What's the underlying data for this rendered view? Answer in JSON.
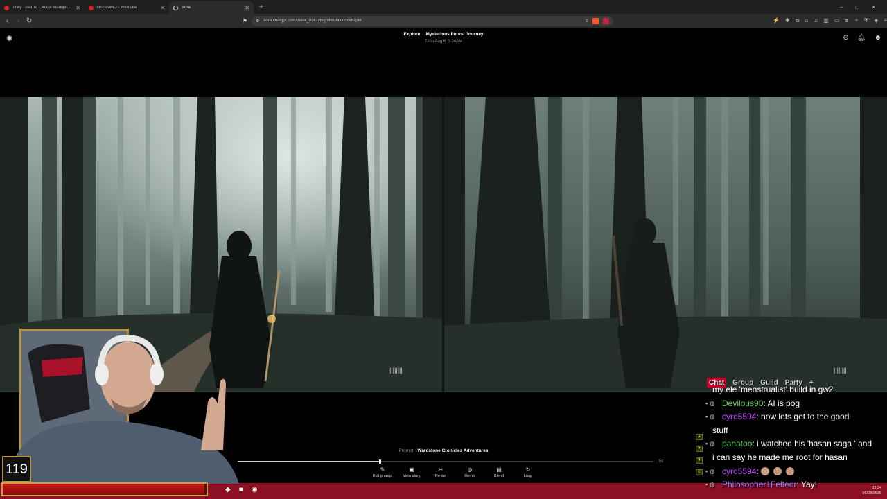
{
  "browser": {
    "tabs": [
      {
        "title": "They Tried To Cancel Markiplier... It",
        "icon": "youtube-icon"
      },
      {
        "title": "RozeMMO - YouTube",
        "icon": "youtube-icon"
      },
      {
        "title": "Sora",
        "icon": "sora-icon",
        "active": true
      }
    ],
    "url": "sora.chatgpt.com/t/task_01k1yfejg9f8s9akx3bfv6zpkr",
    "window_controls": [
      "–",
      "□",
      "✕"
    ]
  },
  "sora": {
    "breadcrumb_section": "Explore",
    "breadcrumb_sep": "·",
    "title": "Mysterious Forest Journey",
    "meta": "720p   Aug 6, 3:20AM",
    "prompt_label": "Prompt",
    "prompt_text": "Wardstone Cronicles Adventures",
    "progress": 0.34,
    "duration_label": "5s",
    "actions": [
      {
        "label": "Edit prompt",
        "icon": "pencil-icon",
        "glyph": "✎"
      },
      {
        "label": "View story",
        "icon": "storyboard-icon",
        "glyph": "▣"
      },
      {
        "label": "Re-cut",
        "icon": "scissors-icon",
        "glyph": "✂"
      },
      {
        "label": "Remix",
        "icon": "remix-icon",
        "glyph": "◎"
      },
      {
        "label": "Blend",
        "icon": "blend-icon",
        "glyph": "▤"
      },
      {
        "label": "Loop",
        "icon": "loop-icon",
        "glyph": "↻"
      }
    ],
    "audio_indicator": "||||||||"
  },
  "overlay": {
    "level": "119",
    "health_fraction": 0.99,
    "chat_tabs": [
      "Chat",
      "Group",
      "Guild",
      "Party",
      "+"
    ],
    "messages": [
      {
        "user": "",
        "text": "my ele 'menstrualist' build in gw2",
        "color": "#ffffff",
        "partial": true
      },
      {
        "user": "Devilous90",
        "text": ": AI is pog",
        "color": "#5fd35f"
      },
      {
        "user": "cyro5594",
        "text": ": now lets get to the good",
        "color": "#c84bff"
      },
      {
        "user": "",
        "text": "stuff",
        "color": "#ffffff",
        "continuation": true
      },
      {
        "user": "panatoo",
        "text": ": i watched his 'hasan saga ' and",
        "color": "#5fd35f"
      },
      {
        "user": "",
        "text": "i can say he made me root for hasan",
        "color": "#ffffff",
        "continuation": true
      },
      {
        "user": "cyro5594",
        "text": ":",
        "color": "#c84bff",
        "emotes": 3
      },
      {
        "user": "Philosopher1Felteor",
        "text": ": Yay!",
        "color": "#9a7bff"
      }
    ]
  },
  "taskbar": {
    "time": "03:34",
    "date": "06/08/2025"
  }
}
